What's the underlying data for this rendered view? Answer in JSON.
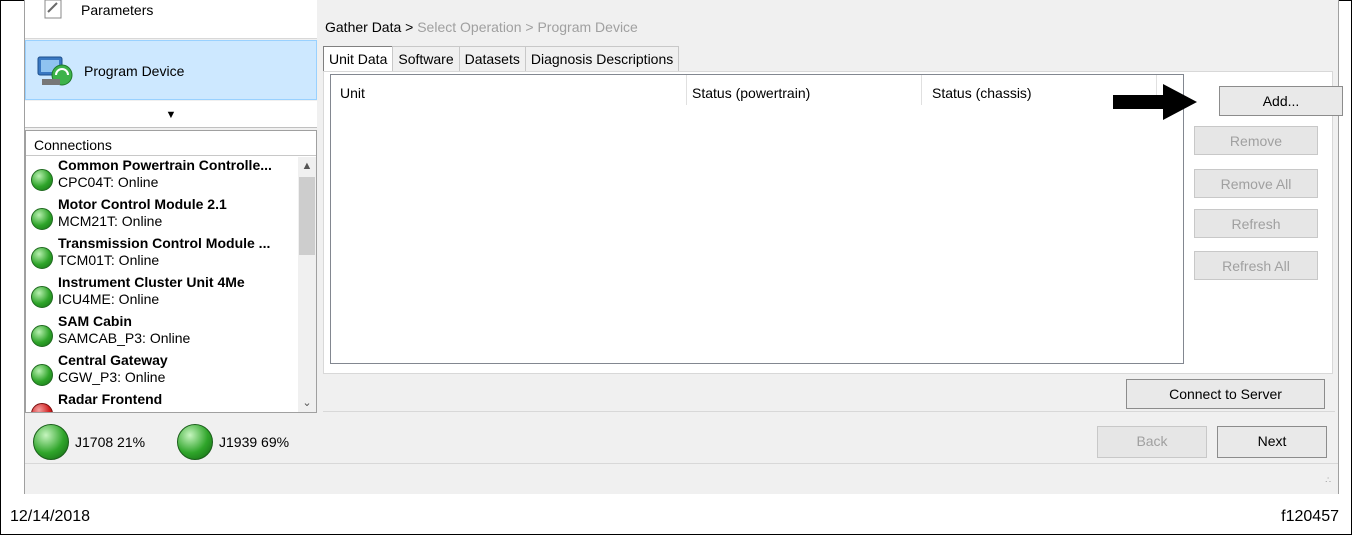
{
  "nav": {
    "parameters_label": "Parameters",
    "program_device_label": "Program Device",
    "expand_icon": "chevron-down-icon"
  },
  "connections": {
    "header": "Connections",
    "items": [
      {
        "name": "Common Powertrain Controlle...",
        "status": "CPC04T: Online",
        "state": "green"
      },
      {
        "name": "Motor Control Module 2.1",
        "status": "MCM21T: Online",
        "state": "green"
      },
      {
        "name": "Transmission Control Module ...",
        "status": "TCM01T: Online",
        "state": "green"
      },
      {
        "name": "Instrument Cluster Unit 4Me",
        "status": "ICU4ME: Online",
        "state": "green"
      },
      {
        "name": "SAM Cabin",
        "status": "SAMCAB_P3: Online",
        "state": "green"
      },
      {
        "name": "Central Gateway",
        "status": "CGW_P3: Online",
        "state": "green"
      },
      {
        "name": "Radar Frontend",
        "status": "",
        "state": "red"
      }
    ]
  },
  "bus": {
    "j1708": "J1708 21%",
    "j1939": "J1939 69%"
  },
  "breadcrumb": {
    "step1": "Gather Data >",
    "step2": "Select Operation >",
    "step3": "Program Device"
  },
  "tabs": [
    "Unit Data",
    "Software",
    "Datasets",
    "Diagnosis Descriptions"
  ],
  "grid": {
    "columns": [
      "Unit",
      "Status (powertrain)",
      "Status (chassis)"
    ]
  },
  "buttons": {
    "add": "Add...",
    "remove": "Remove",
    "remove_all": "Remove All",
    "refresh": "Refresh",
    "refresh_all": "Refresh All",
    "connect_server": "Connect to Server",
    "back": "Back",
    "next": "Next"
  },
  "footer": {
    "date": "12/14/2018",
    "figure_id": "f120457"
  },
  "colors": {
    "selected_nav": "#cde8ff",
    "online": "#2fa52a",
    "offline": "#d02020"
  }
}
